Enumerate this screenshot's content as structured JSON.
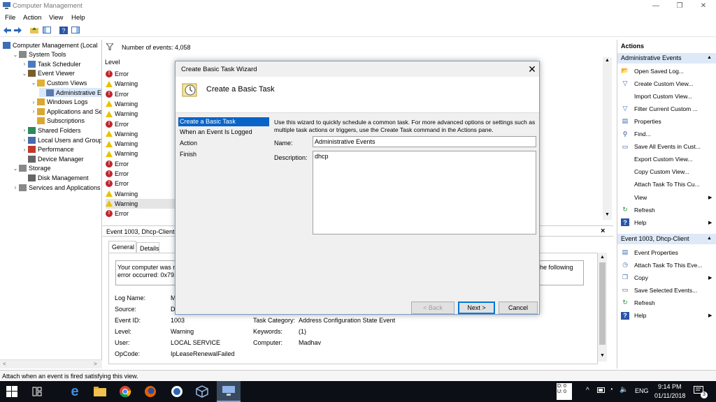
{
  "window": {
    "title": "Computer Management"
  },
  "menu": [
    "File",
    "Action",
    "View",
    "Help"
  ],
  "tree": [
    {
      "label": "Computer Management (Local",
      "indent": 0,
      "exp": ""
    },
    {
      "label": "System Tools",
      "indent": 1,
      "exp": "v"
    },
    {
      "label": "Task Scheduler",
      "indent": 2,
      "exp": ">"
    },
    {
      "label": "Event Viewer",
      "indent": 2,
      "exp": "v"
    },
    {
      "label": "Custom Views",
      "indent": 3,
      "exp": "v"
    },
    {
      "label": "Administrative E",
      "indent": 4,
      "exp": "",
      "selected": true
    },
    {
      "label": "Windows Logs",
      "indent": 3,
      "exp": ">"
    },
    {
      "label": "Applications and Se",
      "indent": 3,
      "exp": ">"
    },
    {
      "label": "Subscriptions",
      "indent": 3,
      "exp": ""
    },
    {
      "label": "Shared Folders",
      "indent": 2,
      "exp": ">"
    },
    {
      "label": "Local Users and Groups",
      "indent": 2,
      "exp": ">"
    },
    {
      "label": "Performance",
      "indent": 2,
      "exp": ">"
    },
    {
      "label": "Device Manager",
      "indent": 2,
      "exp": ""
    },
    {
      "label": "Storage",
      "indent": 1,
      "exp": "v"
    },
    {
      "label": "Disk Management",
      "indent": 2,
      "exp": ""
    },
    {
      "label": "Services and Applications",
      "indent": 1,
      "exp": ">"
    }
  ],
  "events": {
    "count_label": "Number of events: 4,058",
    "level_header": "Level",
    "rows": [
      "Error",
      "Warning",
      "Error",
      "Warning",
      "Warning",
      "Error",
      "Warning",
      "Warning",
      "Warning",
      "Error",
      "Error",
      "Error",
      "Warning",
      "Warning",
      "Error"
    ]
  },
  "detail": {
    "title": "Event 1003, Dhcp-Client",
    "tabs": [
      "General",
      "Details"
    ],
    "message_line1": "Your computer was n",
    "message_line2": "error occurred: 0x79.",
    "message_right": "he following",
    "fields": {
      "log_name_label": "Log Name:",
      "log_name_value": "M",
      "source_label": "Source:",
      "source_value": "Di",
      "event_id_label": "Event ID:",
      "event_id_value": "1003",
      "level_label": "Level:",
      "level_value": "Warning",
      "user_label": "User:",
      "user_value": "LOCAL SERVICE",
      "opcode_label": "OpCode:",
      "opcode_value": "IpLeaseRenewalFailed",
      "task_category_label": "Task Category:",
      "task_category_value": "Address Configuration State Event",
      "keywords_label": "Keywords:",
      "keywords_value": "(1)",
      "computer_label": "Computer:",
      "computer_value": "Madhav"
    }
  },
  "actions": {
    "header": "Actions",
    "section1": "Administrative Events",
    "items1": [
      {
        "label": "Open Saved Log...",
        "icon": "open-folder-icon"
      },
      {
        "label": "Create Custom View...",
        "icon": "filter-icon"
      },
      {
        "label": "Import Custom View...",
        "icon": ""
      },
      {
        "label": "Filter Current Custom ...",
        "icon": "filter-icon"
      },
      {
        "label": "Properties",
        "icon": "properties-icon"
      },
      {
        "label": "Find...",
        "icon": "find-icon"
      },
      {
        "label": "Save All Events in Cust...",
        "icon": "save-icon"
      },
      {
        "label": "Export Custom View...",
        "icon": ""
      },
      {
        "label": "Copy Custom View...",
        "icon": ""
      },
      {
        "label": "Attach Task To This Cu...",
        "icon": ""
      },
      {
        "label": "View",
        "icon": "",
        "submenu": true
      },
      {
        "label": "Refresh",
        "icon": "refresh-icon"
      },
      {
        "label": "Help",
        "icon": "help-icon",
        "submenu": true
      }
    ],
    "section2": "Event 1003, Dhcp-Client",
    "items2": [
      {
        "label": "Event Properties",
        "icon": "properties-icon"
      },
      {
        "label": "Attach Task To This Eve...",
        "icon": "task-icon"
      },
      {
        "label": "Copy",
        "icon": "copy-icon",
        "submenu": true
      },
      {
        "label": "Save Selected Events...",
        "icon": "save-icon"
      },
      {
        "label": "Refresh",
        "icon": "refresh-icon"
      },
      {
        "label": "Help",
        "icon": "help-icon",
        "submenu": true
      }
    ]
  },
  "status": "Attach when an event is fired satisfying this view.",
  "dialog": {
    "title": "Create Basic Task Wizard",
    "heading": "Create a Basic Task",
    "nav": [
      "Create a Basic Task",
      "When an Event Is Logged",
      "Action",
      "Finish"
    ],
    "description": "Use this wizard to quickly schedule a common task.  For more advanced options or settings such as multiple task actions or triggers, use the Create Task command in the Actions pane.",
    "name_label": "Name:",
    "name_value": "Administrative Events",
    "desc_label": "Description:",
    "desc_value": "dhcp",
    "back": "< Back",
    "next": "Next >",
    "cancel": "Cancel"
  },
  "taskbar": {
    "lang": "ENG",
    "time": "9:14 PM",
    "date": "01/11/2018",
    "notif_count": "3",
    "net_d": "D: 0",
    "net_u": "U: 0"
  }
}
